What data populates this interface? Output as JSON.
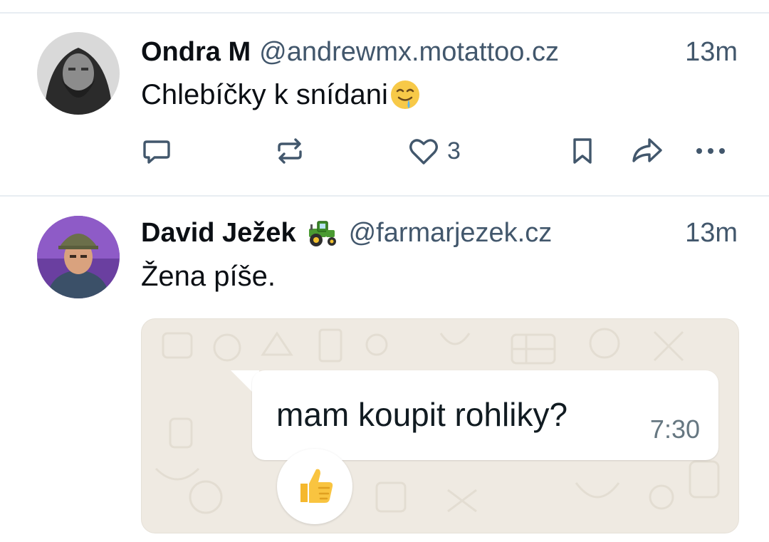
{
  "posts": [
    {
      "display_name": "Ondra M",
      "handle": "@andrewmx.motattoo.cz",
      "time": "13m",
      "text": "Chlebíčky k snídani",
      "text_emoji": "drooling-face",
      "actions": {
        "reply_icon": "reply-icon",
        "repost_icon": "repost-icon",
        "like_icon": "heart-icon",
        "like_count": "3",
        "bookmark_icon": "bookmark-icon",
        "share_icon": "share-icon",
        "more_icon": "more-icon"
      }
    },
    {
      "display_name": "David Ježek",
      "name_badge": "tractor",
      "handle": "@farmarjezek.cz",
      "time": "13m",
      "text": "Žena píše.",
      "embed": {
        "message": "mam koupit rohliky?",
        "message_time": "7:30",
        "reaction": "thumbs-up"
      }
    }
  ],
  "colors": {
    "text_primary": "#0b0f14",
    "text_secondary": "#42576c",
    "divider": "#e8edf2",
    "chat_background": "#efeae2"
  }
}
